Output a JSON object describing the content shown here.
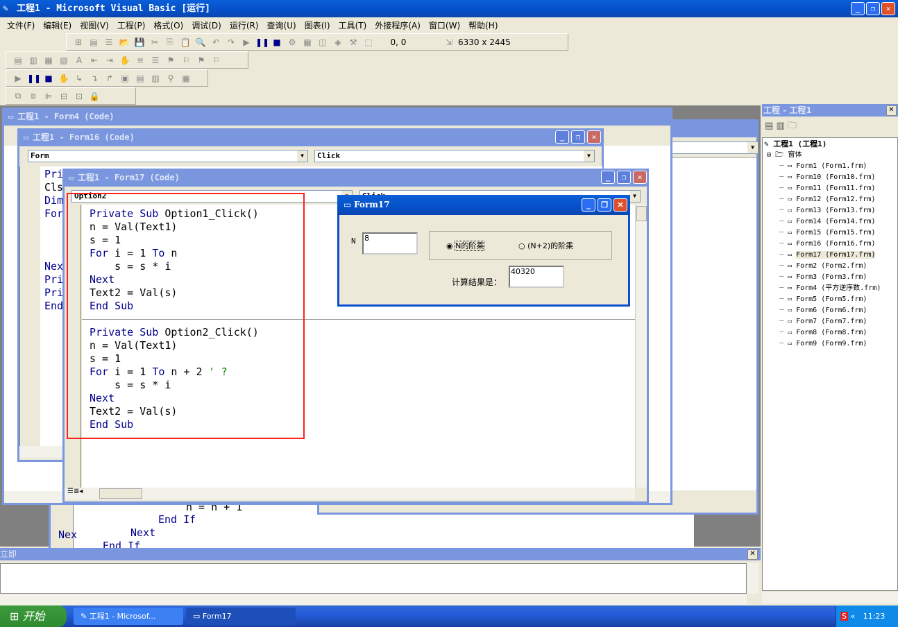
{
  "app": {
    "title": "工程1 - Microsoft Visual Basic [运行]"
  },
  "menu": [
    "文件(F)",
    "编辑(E)",
    "视图(V)",
    "工程(P)",
    "格式(O)",
    "调试(D)",
    "运行(R)",
    "查询(U)",
    "图表(I)",
    "工具(T)",
    "外接程序(A)",
    "窗口(W)",
    "帮助(H)"
  ],
  "toolbar": {
    "position": "0, 0",
    "size": "6330 x 2445"
  },
  "windows": {
    "form4": {
      "title": "工程1 - Form4 (Code)",
      "code": [
        "Pri",
        "Cls",
        "Dim",
        "For",
        "Nex",
        "Pri",
        "Pri",
        "End"
      ]
    },
    "form16": {
      "title": "工程1 - Form16 (Code)",
      "object": "Form",
      "proc": "Click"
    },
    "form_other": {
      "proc": "Click"
    },
    "behind": {
      "lines": [
        "n = n + 1",
        "End If",
        "Next",
        "End If",
        "Nex"
      ]
    },
    "form17": {
      "title": "工程1 - Form17 (Code)",
      "object": "Option2",
      "proc": "Click"
    }
  },
  "code17": [
    [
      [
        "kw",
        "Private Sub "
      ],
      [
        "",
        "Option1_Click()"
      ]
    ],
    [
      [
        "",
        "n = Val(Text1)"
      ]
    ],
    [
      [
        "",
        "s = 1"
      ]
    ],
    [
      [
        "kw",
        "For "
      ],
      [
        "",
        "i = 1 "
      ],
      [
        "kw",
        "To"
      ],
      [
        "",
        " n"
      ]
    ],
    [
      [
        "",
        "    s = s * i"
      ]
    ],
    [
      [
        "kw",
        "Next"
      ]
    ],
    [
      [
        "",
        "Text2 = Val(s)"
      ]
    ],
    [
      [
        "kw",
        "End Sub"
      ]
    ],
    [
      [
        "sep",
        ""
      ]
    ],
    [
      [
        "kw",
        "Private Sub "
      ],
      [
        "",
        "Option2_Click()"
      ]
    ],
    [
      [
        "",
        "n = Val(Text1)"
      ]
    ],
    [
      [
        "",
        "s = 1"
      ]
    ],
    [
      [
        "kw",
        "For "
      ],
      [
        "",
        "i = 1 "
      ],
      [
        "kw",
        "To"
      ],
      [
        "",
        " n + 2 "
      ],
      [
        "cm",
        "' ?"
      ]
    ],
    [
      [
        "",
        "    s = s * i"
      ]
    ],
    [
      [
        "kw",
        "Next"
      ]
    ],
    [
      [
        "",
        "Text2 = Val(s)"
      ]
    ],
    [
      [
        "kw",
        "End Sub"
      ]
    ]
  ],
  "runtime_form": {
    "title": "Form17",
    "n_label": "N",
    "n_value": "8",
    "option1": "N的阶乘",
    "option2": "(N+2)的阶乘",
    "option1_selected": true,
    "result_label": "计算结果是：",
    "result_value": "40320"
  },
  "immediate": {
    "title": "立即"
  },
  "project": {
    "title": "工程 - 工程1",
    "root": "工程1 (工程1)",
    "folder": "窗体",
    "items": [
      "Form1 (Form1.frm)",
      "Form10 (Form10.frm)",
      "Form11 (Form11.frm)",
      "Form12 (Form12.frm)",
      "Form13 (Form13.frm)",
      "Form14 (Form14.frm)",
      "Form15 (Form15.frm)",
      "Form16 (Form16.frm)",
      "Form17 (Form17.frm)",
      "Form2 (Form2.frm)",
      "Form3 (Form3.frm)",
      "Form4 (平方逆序数.frm)",
      "Form5 (Form5.frm)",
      "Form6 (Form6.frm)",
      "Form7 (Form7.frm)",
      "Form8 (Form8.frm)",
      "Form9 (Form9.frm)"
    ],
    "selected": "Form17 (Form17.frm)"
  },
  "taskbar": {
    "start": "开始",
    "tasks": [
      "工程1 - Microsof...",
      "Form17"
    ],
    "clock": "11:23"
  },
  "colors": {
    "highlight": "#ff0000",
    "keyword": "#00008b",
    "comment": "#008000"
  }
}
